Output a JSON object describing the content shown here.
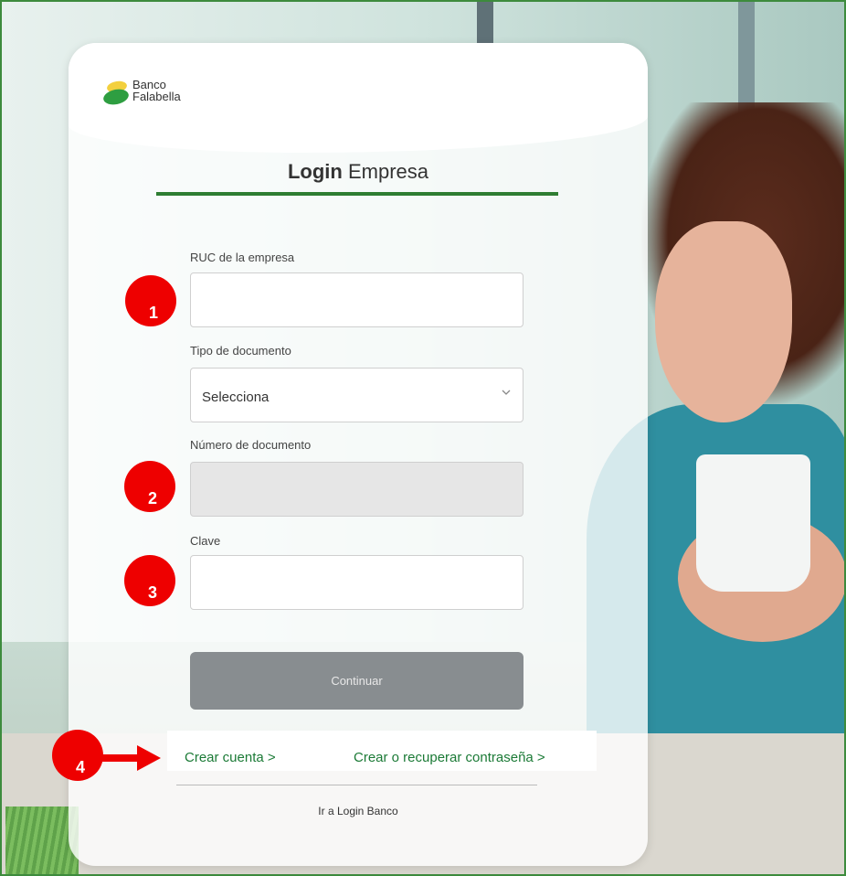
{
  "brand": {
    "line1": "Banco",
    "line2": "Falabella",
    "mark_colors": [
      "#2e9e41",
      "#f3d03e"
    ]
  },
  "title": {
    "bold": "Login",
    "regular": "Empresa",
    "accent_color": "#2e7d32"
  },
  "form": {
    "ruc": {
      "label": "RUC de la empresa",
      "value": ""
    },
    "tipo_documento": {
      "label": "Tipo de documento",
      "selected": "Selecciona"
    },
    "numero_documento": {
      "label": "Número de documento",
      "value": "",
      "disabled": true
    },
    "clave": {
      "label": "Clave",
      "value": ""
    },
    "submit_label": "Continuar"
  },
  "links": {
    "crear_cuenta": "Crear cuenta >",
    "recuperar": "Crear o recuperar contraseña >",
    "login_banco": "Ir a Login Banco"
  },
  "annotations": {
    "markers": [
      "1",
      "2",
      "3",
      "4"
    ],
    "color": "#ee0000"
  }
}
